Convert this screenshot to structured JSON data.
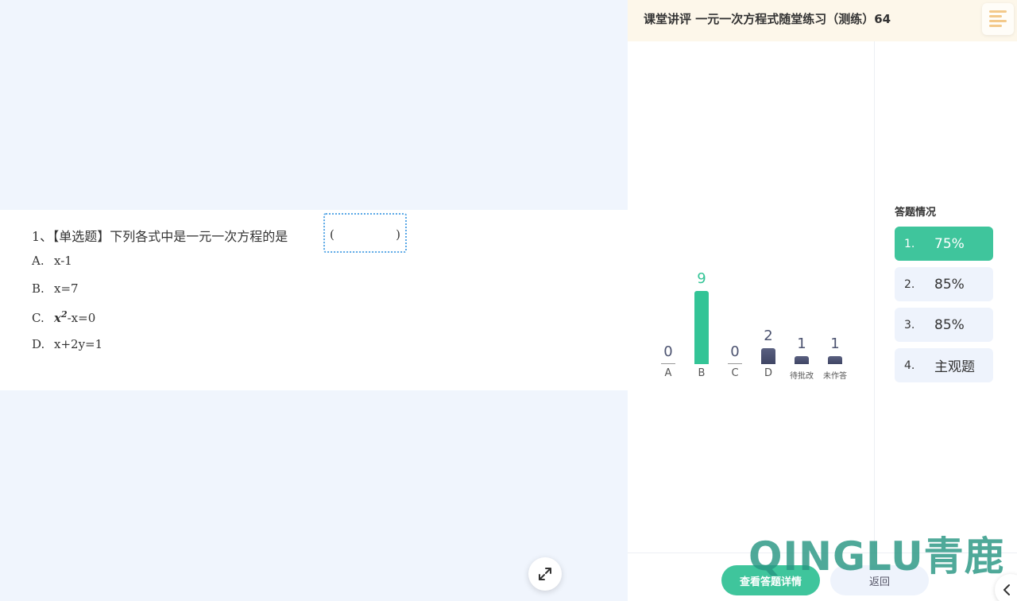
{
  "header": {
    "title": "课堂讲评 一元一次方程式随堂练习（测练）64"
  },
  "question": {
    "number": "1、",
    "type": "【单选题】",
    "stem": "下列各式中是一元一次方程的是",
    "paren_left": "(",
    "paren_right": ")",
    "options": [
      {
        "letter": "A.",
        "text": "x-1"
      },
      {
        "letter": "B.",
        "text": "x=7"
      },
      {
        "letter": "C.",
        "base": "x",
        "sup": "2",
        "text": "-x=0"
      },
      {
        "letter": "D.",
        "text": "x+2y=1"
      }
    ]
  },
  "chart_data": {
    "type": "bar",
    "categories": [
      "A",
      "B",
      "C",
      "D",
      "待批改",
      "未作答"
    ],
    "values": [
      0,
      9,
      0,
      2,
      1,
      1
    ],
    "highlight_category": "B",
    "colors": {
      "highlight": "#33c496",
      "normal": "#4c5370"
    }
  },
  "status": {
    "title": "答题情况",
    "items": [
      {
        "num": "1.",
        "value": "75%",
        "active": true
      },
      {
        "num": "2.",
        "value": "85%",
        "active": false
      },
      {
        "num": "3.",
        "value": "85%",
        "active": false
      },
      {
        "num": "4.",
        "value": "主观题",
        "active": false
      }
    ]
  },
  "buttons": {
    "detail": "查看答题详情",
    "back": "返回"
  },
  "watermark": "QINGLU青鹿"
}
